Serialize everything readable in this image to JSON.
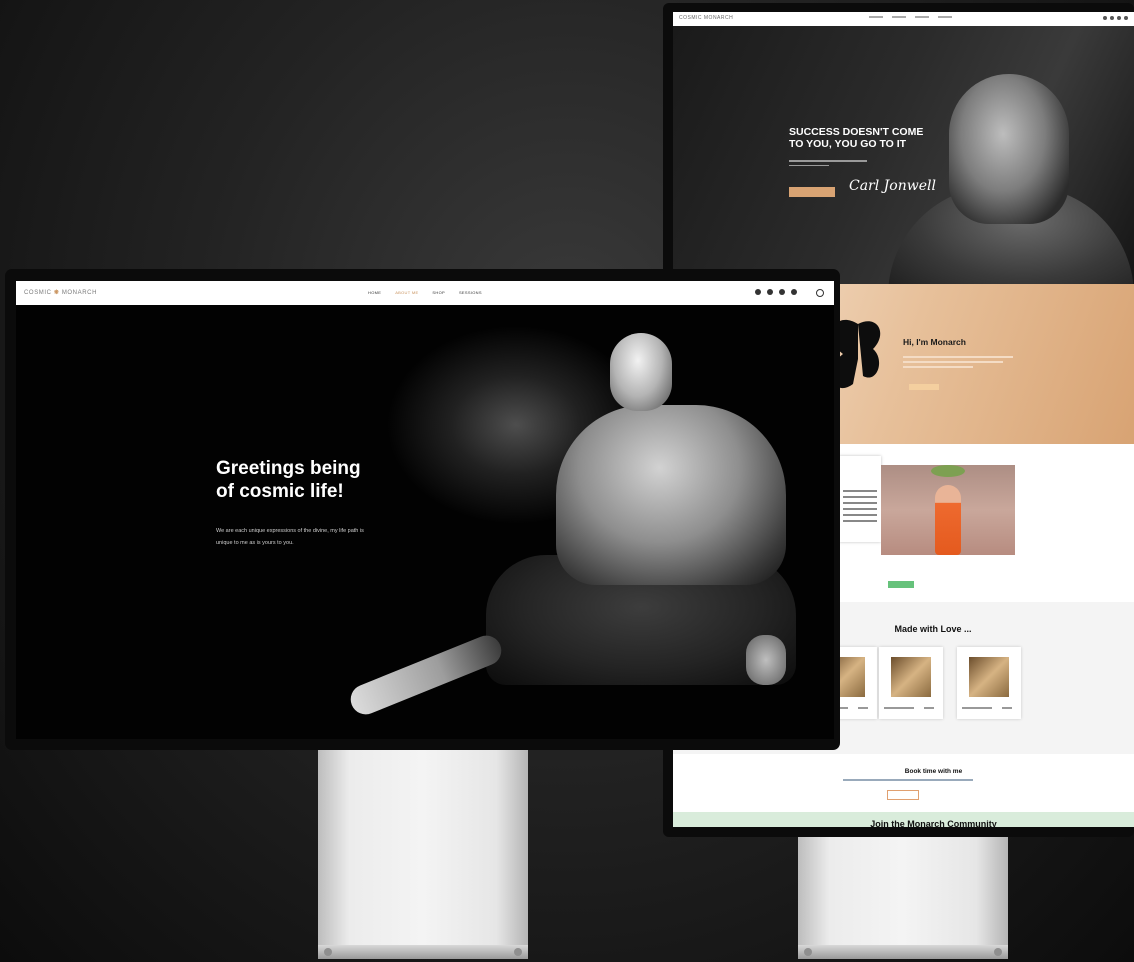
{
  "left_site": {
    "logo": {
      "prefix": "COSMIC",
      "suffix": "MONARCH"
    },
    "nav": {
      "items": [
        {
          "label": "HOME"
        },
        {
          "label": "ABOUT ME",
          "active": true
        },
        {
          "label": "SHOP"
        },
        {
          "label": "SESSIONS"
        }
      ],
      "social_icons": [
        "instagram-icon",
        "tiktok-icon",
        "youtube-icon",
        "facebook-icon"
      ],
      "search_icon": "search-icon"
    },
    "hero": {
      "title_line1": "Greetings being",
      "title_line2": "of cosmic life!",
      "subtitle_line1": "We are each unique expressions of the divine, my life path is",
      "subtitle_line2": "unique to me as is yours to you."
    }
  },
  "right_site": {
    "logo": "COSMIC MONARCH",
    "hero": {
      "title_line1": "SUCCESS DOESN'T COME",
      "title_line2": "TO YOU, YOU GO TO IT",
      "signature": "Carl Jonwell"
    },
    "about": {
      "heading": "Hi, I'm Monarch"
    },
    "made": {
      "heading": "Made with Love ..."
    },
    "book": {
      "heading": "Book time with me"
    },
    "join": {
      "heading": "Join the Monarch Community"
    }
  },
  "colors": {
    "accent": "#c9935e",
    "peach": "#d8a373",
    "green": "#66c27b"
  }
}
